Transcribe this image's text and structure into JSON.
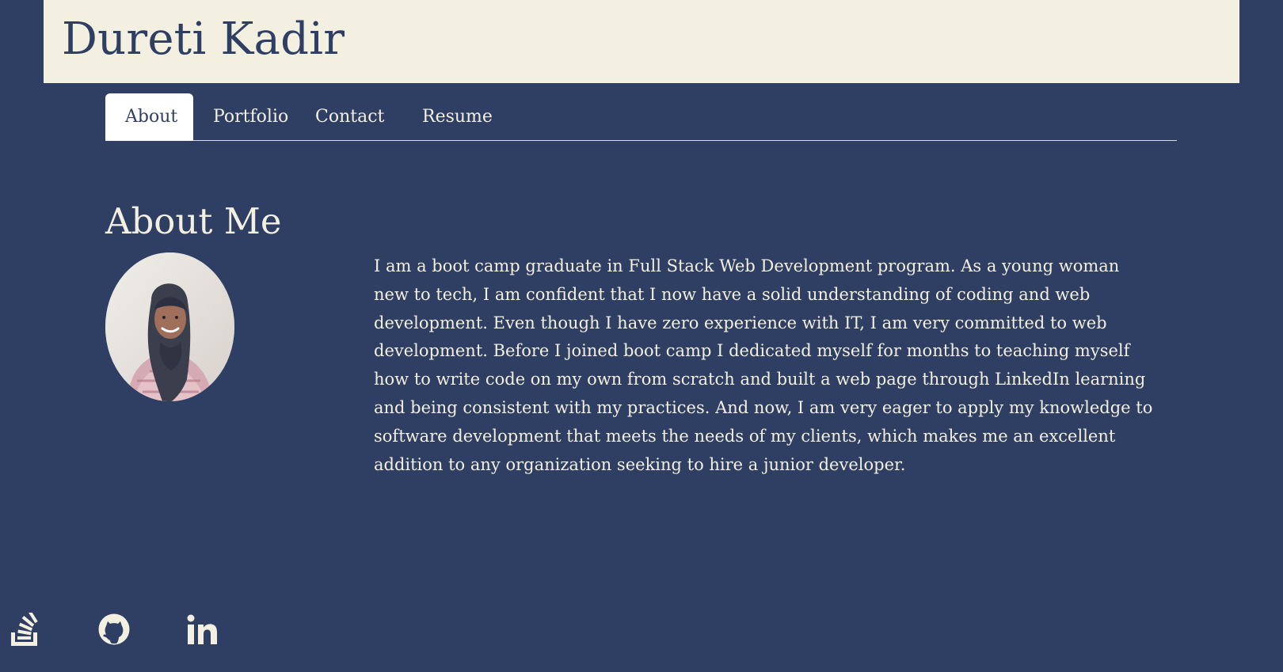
{
  "header": {
    "title": "Dureti Kadir"
  },
  "nav": {
    "tabs": [
      {
        "label": "About",
        "active": true
      },
      {
        "label": "Portfolio",
        "active": false
      },
      {
        "label": "Contact",
        "active": false
      },
      {
        "label": "Resume",
        "active": false
      }
    ]
  },
  "about": {
    "heading": "About Me",
    "bio": "I am a boot camp graduate in Full Stack Web Development program. As a young woman new to tech, I am confident that I now have a solid understanding of coding and web development. Even though I have zero experience with IT, I am very committed to web development. Before I joined boot camp I dedicated myself for months to teaching myself how to write code on my own from scratch and built a web page through LinkedIn learning and being consistent with my practices. And now, I am very eager to apply my knowledge to software development that meets the needs of my clients, which makes me an excellent addition to any organization seeking to hire a junior developer."
  },
  "social": {
    "items": [
      {
        "icon": "stack-overflow-icon"
      },
      {
        "icon": "github-icon"
      },
      {
        "icon": "linkedin-icon"
      }
    ]
  },
  "colors": {
    "page_background": "#2e3f63",
    "header_background": "#f3efe1",
    "text_light": "#f3efe1",
    "text_dark": "#2e3f63",
    "active_tab_background": "#ffffff"
  }
}
